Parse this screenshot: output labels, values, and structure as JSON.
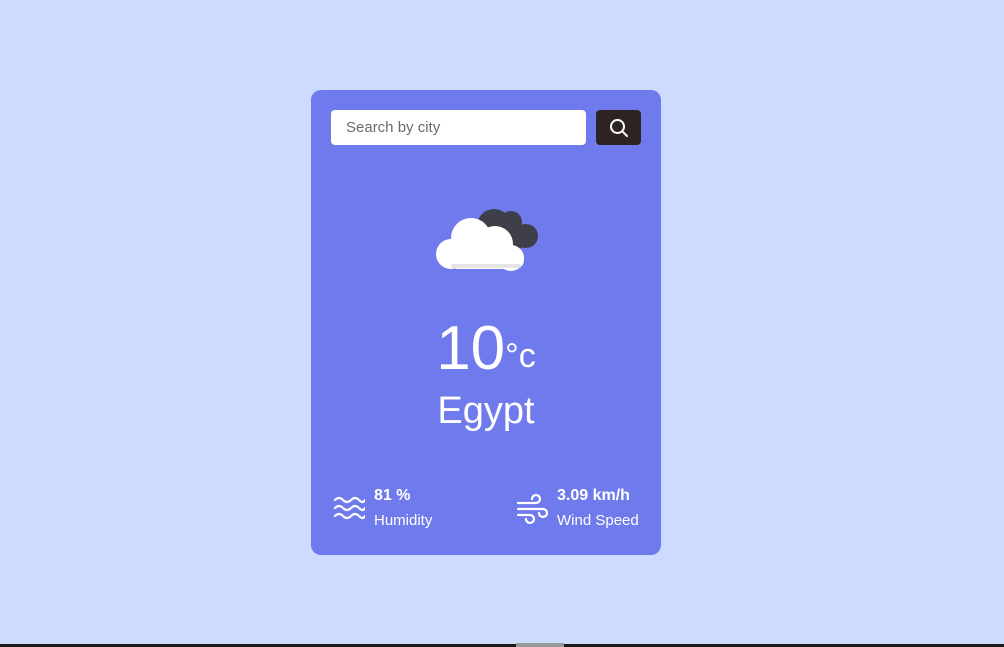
{
  "search": {
    "placeholder": "Search by city",
    "value": ""
  },
  "icons": {
    "search": "search-icon",
    "weather": "cloud-icon",
    "humidity": "waves-icon",
    "wind": "wind-icon"
  },
  "weather": {
    "temperature": "10",
    "unit": "°c",
    "city": "Egypt"
  },
  "details": {
    "humidity": {
      "value": "81 %",
      "label": "Humidity"
    },
    "wind": {
      "value": "3.09 km/h",
      "label": "Wind Speed"
    }
  },
  "colors": {
    "background": "#cddbfe",
    "card": "#6f7aec",
    "search_button": "#2f2424",
    "text": "#ffffff"
  }
}
